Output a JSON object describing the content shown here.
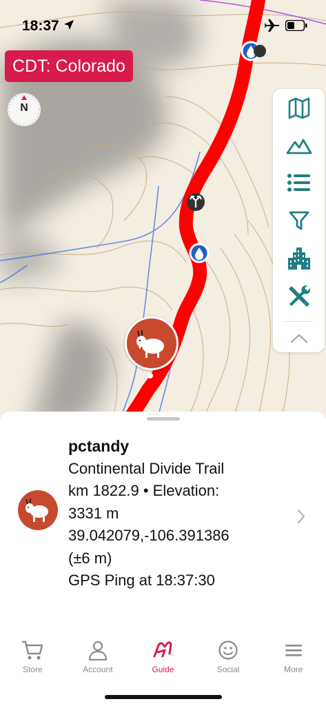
{
  "status_bar": {
    "time": "18:37",
    "icons": [
      "location-arrow-icon",
      "airplane-icon",
      "battery-icon"
    ]
  },
  "map": {
    "region_label": "CDT: Colorado",
    "compass_letter": "N",
    "toolbar": [
      "map-icon",
      "mountains-icon",
      "list-icon",
      "filter-icon",
      "buildings-icon",
      "tools-icon",
      "chevron-up-icon"
    ],
    "colors": {
      "trail": "#ff0000",
      "toolbar_icon": "#1f7f86",
      "water": "#2563c9",
      "label": "#d81b4a"
    }
  },
  "info": {
    "name": "pctandy",
    "trail": "Continental Divide Trail",
    "km_elev_line1": "km 1822.9 • Elevation:",
    "km_elev_line2": "3331 m",
    "coords": "39.042079,-106.391386",
    "accuracy": "(±6 m)",
    "ping": "GPS Ping at 18:37:30"
  },
  "tabs": [
    {
      "label": "Store",
      "icon": "cart-icon",
      "active": false
    },
    {
      "label": "Account",
      "icon": "person-icon",
      "active": false
    },
    {
      "label": "Guide",
      "icon": "guide-logo-icon",
      "active": true
    },
    {
      "label": "Social",
      "icon": "smiley-icon",
      "active": false
    },
    {
      "label": "More",
      "icon": "hamburger-icon",
      "active": false
    }
  ]
}
